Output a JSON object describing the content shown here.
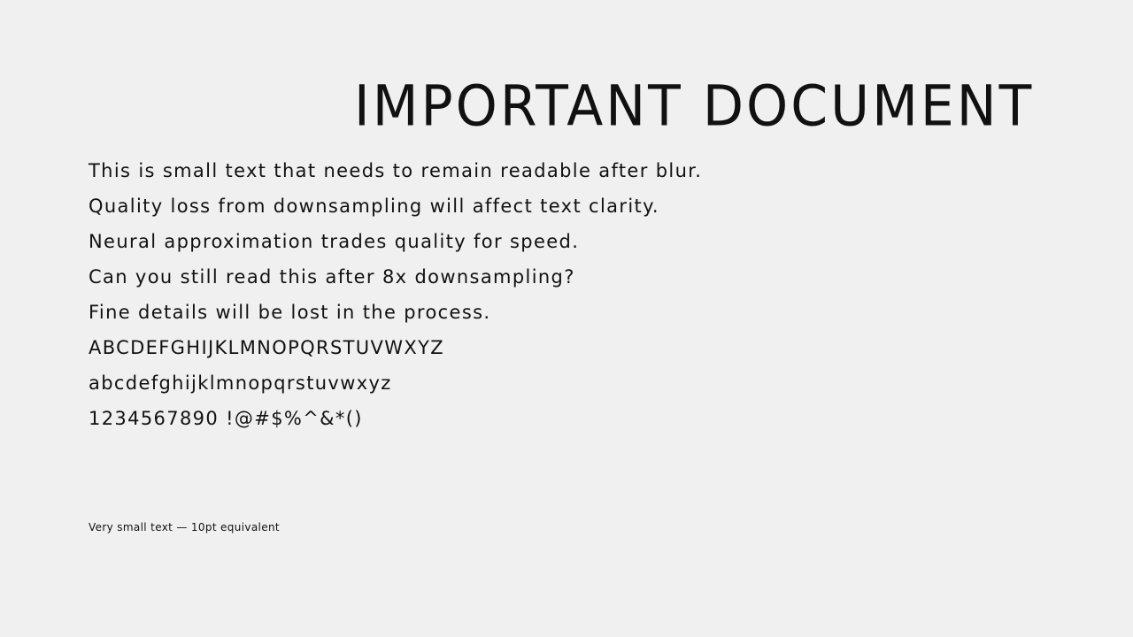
{
  "document": {
    "title": "IMPORTANT DOCUMENT",
    "lines": [
      "This is small text that needs to remain readable after blur.",
      "Quality loss from downsampling will affect text clarity.",
      "Neural approximation trades quality for speed.",
      "Can you still read this after 8x downsampling?",
      "Fine details will be lost in the process.",
      "ABCDEFGHIJKLMNOPQRSTUVWXYZ",
      "abcdefghijklmnopqrstuvwxyz",
      "1234567890 !@#$%^&*()"
    ],
    "small_text": "Very small text — 10pt equivalent"
  }
}
